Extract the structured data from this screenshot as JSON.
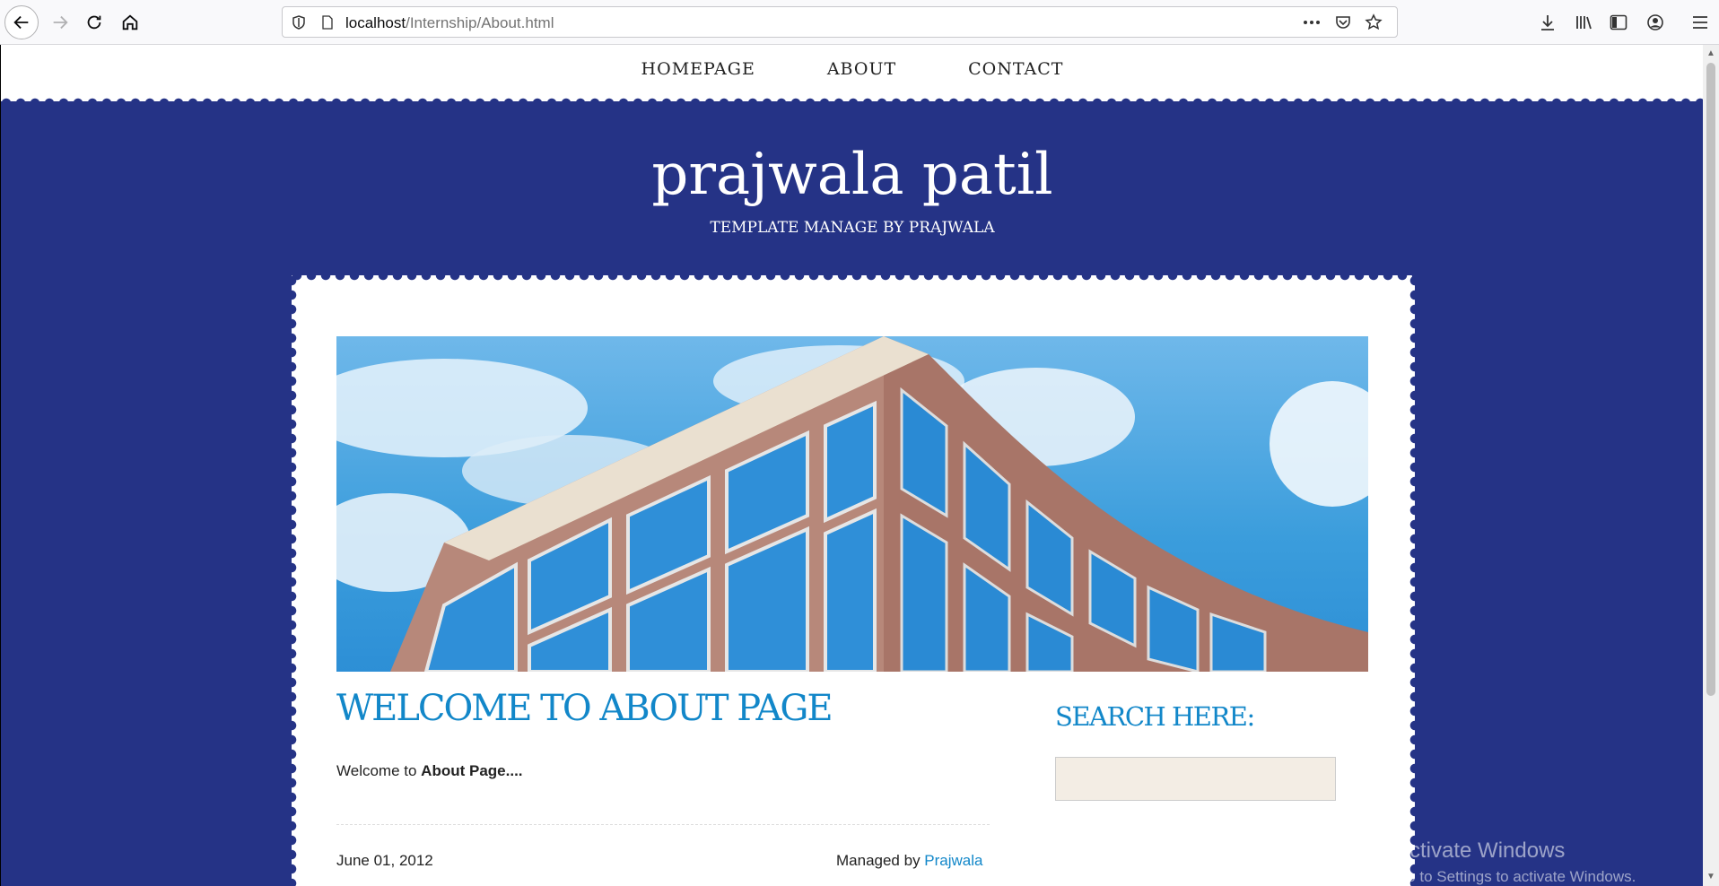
{
  "browser": {
    "url_host": "localhost",
    "url_path": "/Internship/About.html"
  },
  "nav": {
    "items": [
      "HOMEPAGE",
      "ABOUT",
      "CONTACT"
    ]
  },
  "header": {
    "title": "prajwala patil",
    "subtitle": "TEMPLATE MANAGE BY PRAJWALA"
  },
  "main": {
    "heading": "WELCOME TO ABOUT PAGE",
    "text_prefix": "Welcome to ",
    "text_bold": "About Page....",
    "date": "June 01, 2012",
    "managed_prefix": "Managed by ",
    "managed_link": "Prajwala"
  },
  "sidebar": {
    "search_title": "SEARCH HERE:"
  },
  "watermark": {
    "line1": "Activate Windows",
    "line2": "Go to Settings to activate Windows."
  },
  "colors": {
    "page_bg": "#253386",
    "accent": "#1287c9",
    "search_bg": "#f3ede4"
  }
}
